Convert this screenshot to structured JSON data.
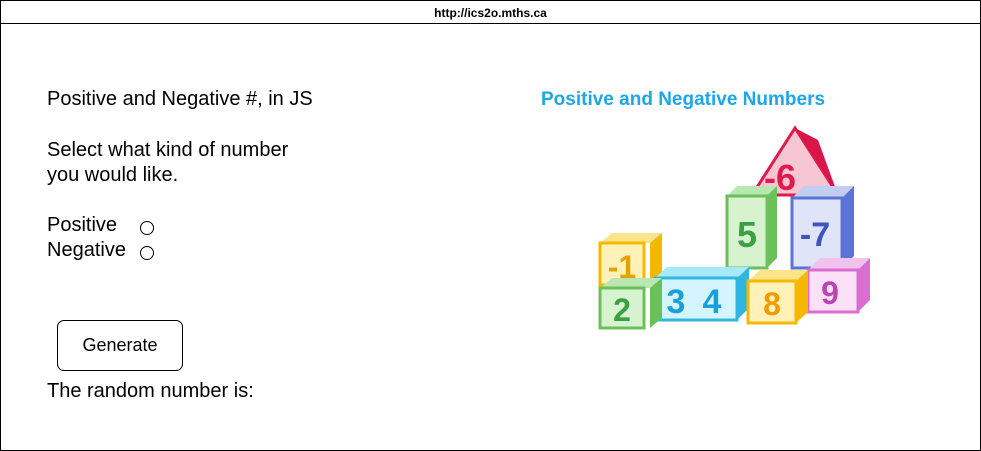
{
  "browser": {
    "url": "http://ics2o.mths.ca"
  },
  "page": {
    "heading": "Positive and Negative #, in JS",
    "instruction_line1": "Select what kind of number",
    "instruction_line2": "you would like.",
    "options": [
      {
        "label": "Positive",
        "selected": false
      },
      {
        "label": "Negative",
        "selected": false
      }
    ],
    "generate_button": "Generate",
    "result_label": "The random number is:"
  },
  "illustration": {
    "title": "Positive and Negative Numbers",
    "blocks": [
      "-6",
      "5",
      "-7",
      "-1",
      "3",
      "4",
      "9",
      "2",
      "8"
    ]
  }
}
